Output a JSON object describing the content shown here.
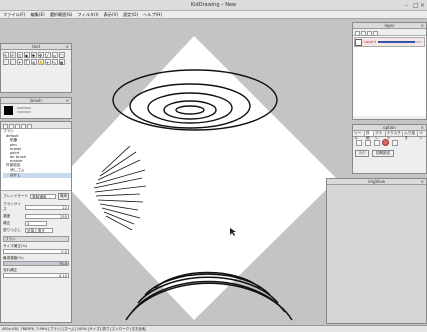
{
  "window": {
    "title": "KidDrawing – New"
  },
  "menu": [
    "ファイル(F)",
    "編集(E)",
    "選択範囲(S)",
    "フィルタ(I)",
    "表示(V)",
    "設定(O)",
    "ヘルプ(H)"
  ],
  "tool_panel": {
    "title": "tool"
  },
  "brush_panel": {
    "title": "brush"
  },
  "tree": {
    "items": [
      "ブラシ",
      "default",
      "鉛筆",
      "pen",
      "eraser",
      "paint",
      "air brush",
      "marker",
      "外部追加",
      "消しゴム",
      "ぼかし"
    ]
  },
  "settings": {
    "rows": [
      {
        "label": "ブラシサイズ",
        "value": "22"
      },
      {
        "label": "濃度",
        "value": "255"
      },
      {
        "label": "補正",
        "value": "3"
      },
      {
        "label": "塗りつぶし",
        "value": "近接上書き"
      }
    ],
    "mode_label": "ブレンドモード",
    "mode_value": "常時適用",
    "apply_btn": "適用",
    "section_title": "ブラシ",
    "sliders": [
      {
        "label": "サイズ補正(%)",
        "value": "0.0"
      },
      {
        "label": "最低濃度(%)",
        "value": "70.0"
      },
      {
        "label": "流れ補正",
        "value": "0.10"
      }
    ]
  },
  "layer_panel": {
    "title": "layer",
    "layer_name": "Layer1",
    "progress": 0.85,
    "accent": "#cc2222"
  },
  "option_panel": {
    "title": "option",
    "tabs": [
      "ツール",
      "詳細",
      "ブラシ",
      "テクスチャ",
      "入り抜き",
      "ペン"
    ],
    "btn1": "適用",
    "btn2": "初期設定"
  },
  "img_view": {
    "title": "imgView"
  },
  "status": {
    "text": "400×430, 7683PX, 7.99% [ブラシ] [ズーム] 100% [サイズ] 原寸 [ストローク] 左右反転"
  }
}
